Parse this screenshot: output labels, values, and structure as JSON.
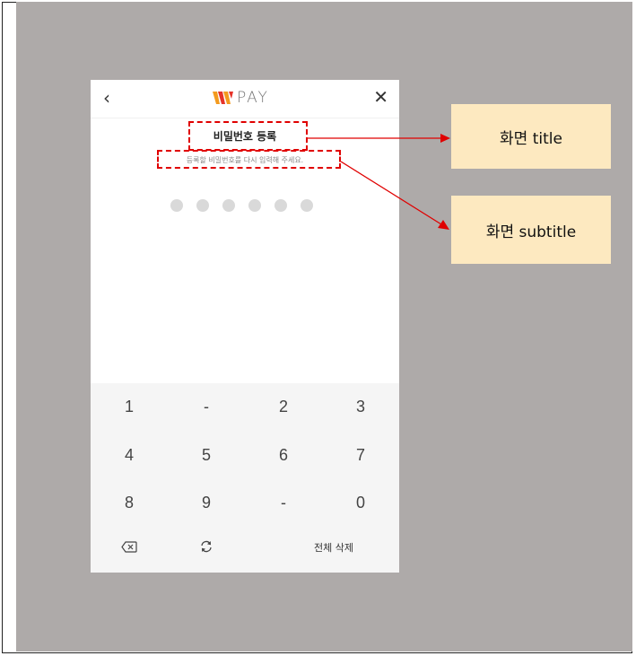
{
  "app": {
    "logo_text": "PAY",
    "back_icon": "chevron-left-icon",
    "close_icon": "close-icon"
  },
  "screen": {
    "title": "비밀번호 등록",
    "subtitle": "등록할 비밀번호를 다시 입력해 주세요.",
    "pin_length": 6,
    "pin_filled": 0
  },
  "keypad": {
    "rows": [
      [
        "1",
        "-",
        "2",
        "3"
      ],
      [
        "4",
        "5",
        "6",
        "7"
      ],
      [
        "8",
        "9",
        "-",
        "0"
      ]
    ],
    "backspace_icon": "backspace-icon",
    "refresh_icon": "refresh-icon",
    "clear_all_label": "전체 삭제"
  },
  "annotations": {
    "title_callout": "화면 title",
    "subtitle_callout": "화면 subtitle"
  },
  "colors": {
    "background": "#aeaaa9",
    "callout_fill": "#fde9c0",
    "annotation_red": "#e00000",
    "logo_w_orange": "#f39a1e",
    "logo_w_red": "#e6332a",
    "pin_dot": "#d9d9d9"
  }
}
